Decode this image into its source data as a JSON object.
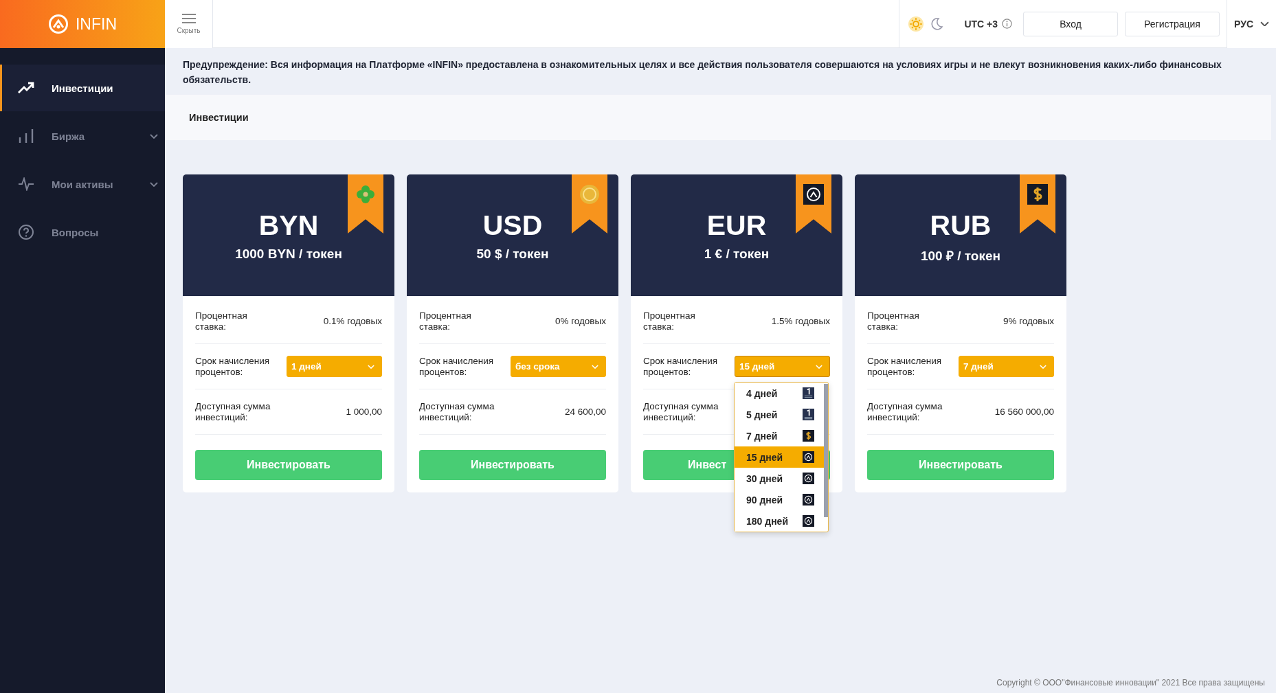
{
  "brand": {
    "name": "INFIN"
  },
  "menu_toggle": {
    "label": "Скрыть"
  },
  "header": {
    "theme_options": [
      {
        "kind": "sun",
        "selected": true
      },
      {
        "kind": "moon",
        "selected": false
      }
    ],
    "utc": "UTC +3",
    "buttons": [
      "Вход",
      "Регистрация"
    ],
    "language": "РУС"
  },
  "sidebar": {
    "items": [
      {
        "label": "Инвестиции",
        "kind": "trend",
        "selected": true
      },
      {
        "label": "Биржа",
        "kind": "bars",
        "selected": false,
        "expanded": false
      },
      {
        "label": "Мои активы",
        "kind": "pulse",
        "selected": false,
        "expanded": false
      },
      {
        "label": "Вопросы",
        "kind": "help",
        "selected": false
      }
    ]
  },
  "warning": "Предупреждение: Вся информация на Платформе «INFIN» предоставлена в ознакомительных целях и все действия пользователя совершаются на условиях игры и не влекут возникновения каких-либо финансовых обязательств.",
  "breadcrumb": "Инвестиции",
  "cards": [
    {
      "currency": "BYN",
      "price": "1000 BYN / токен",
      "kind": "clover",
      "rate_label": "Процентная ставка:",
      "rate": "0.1% годовых",
      "term_label": "Срок начисления процентов:",
      "term": "1 дней",
      "open": false,
      "sum_label": "Доступная сумма инвестиций:",
      "sum": "1 000,00",
      "button": "Инвестировать"
    },
    {
      "currency": "USD",
      "price": "50 $ / токен",
      "kind": "coin",
      "rate_label": "Процентная ставка:",
      "rate": "0% годовых",
      "term_label": "Срок начисления процентов:",
      "term": "без срока",
      "open": false,
      "sum_label": "Доступная сумма инвестиций:",
      "sum": "24 600,00",
      "button": "Инвестировать"
    },
    {
      "currency": "EUR",
      "price": "1 € / токен",
      "kind": "logo",
      "rate_label": "Процентная ставка:",
      "rate": "1.5% годовых",
      "term_label": "Срок начисления процентов:",
      "term": "15 дней",
      "open": true,
      "sum_label": "Доступная сумма инвестиций:",
      "button": "Инвест",
      "options": [
        {
          "label": "4 дней",
          "kind": "onewin",
          "selected": false
        },
        {
          "label": "5 дней",
          "kind": "onewin",
          "selected": false
        },
        {
          "label": "7 дней",
          "kind": "dollar",
          "selected": false
        },
        {
          "label": "15 дней",
          "kind": "logo",
          "selected": true
        },
        {
          "label": "30 дней",
          "kind": "logo",
          "selected": false
        },
        {
          "label": "90 дней",
          "kind": "logo",
          "selected": false
        },
        {
          "label": "180 дней",
          "kind": "logo",
          "selected": false
        }
      ]
    },
    {
      "currency": "RUB",
      "price": "100 ₽ / токен",
      "kind": "dollar",
      "rate_label": "Процентная ставка:",
      "rate": "9% годовых",
      "term_label": "Срок начисления процентов:",
      "term": "7 дней",
      "open": false,
      "sum_label": "Доступная сумма инвестиций:",
      "sum": "16 560 000,00",
      "button": "Инвестировать"
    }
  ],
  "footer": "Copyright © ООО\"Финансовые инновации\" 2021 Все права защищены"
}
